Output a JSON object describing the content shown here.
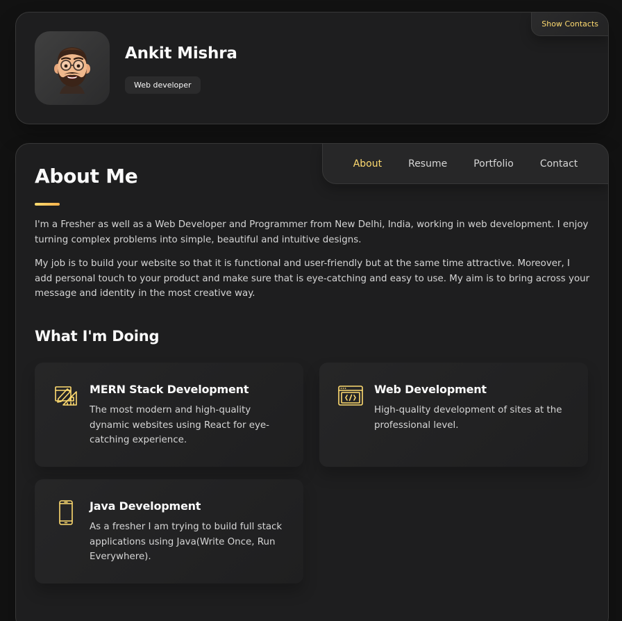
{
  "profile": {
    "name": "Ankit Mishra",
    "title": "Web developer",
    "show_contacts_label": "Show Contacts"
  },
  "nav": {
    "items": [
      {
        "label": "About",
        "active": true
      },
      {
        "label": "Resume",
        "active": false
      },
      {
        "label": "Portfolio",
        "active": false
      },
      {
        "label": "Contact",
        "active": false
      }
    ]
  },
  "about": {
    "title": "About Me",
    "paragraphs": [
      "I'm a Fresher as well as a Web Developer and Programmer from New Delhi, India, working in web development. I enjoy turning complex problems into simple, beautiful and intuitive designs.",
      "My job is to build your website so that it is functional and user-friendly but at the same time attractive. Moreover, I add personal touch to your product and make sure that is eye-catching and easy to use. My aim is to bring across your message and identity in the most creative way."
    ]
  },
  "services": {
    "title": "What I'm Doing",
    "items": [
      {
        "icon": "design-tools-icon",
        "title": "MERN Stack Development",
        "text": "The most modern and high-quality dynamic websites using React for eye-catching experience."
      },
      {
        "icon": "code-window-icon",
        "title": "Web Development",
        "text": "High-quality development of sites at the professional level."
      },
      {
        "icon": "mobile-phone-icon",
        "title": "Java Development",
        "text": "As a fresher I am trying to build full stack applications using Java(Write Once, Run Everywhere)."
      }
    ]
  },
  "colors": {
    "accent": "#ffdb70",
    "background": "#121212",
    "card": "#1e1e1f",
    "text": "#d6d6d6"
  }
}
